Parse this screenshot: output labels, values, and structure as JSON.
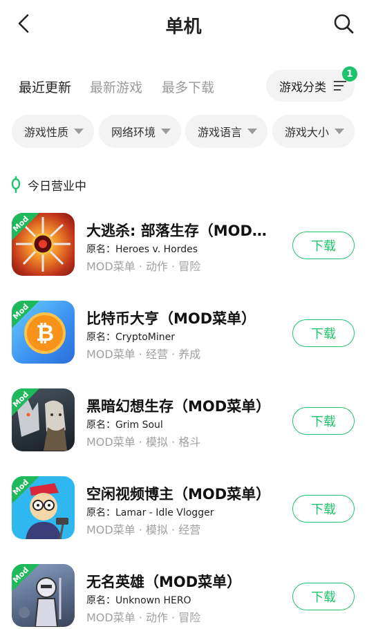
{
  "header": {
    "title": "单机",
    "back_icon": "chevron-left-icon",
    "search_icon": "search-icon"
  },
  "tabs": [
    {
      "label": "最近更新",
      "active": true
    },
    {
      "label": "最新游戏",
      "active": false
    },
    {
      "label": "最多下载",
      "active": false
    }
  ],
  "category_button": {
    "label": "游戏分类",
    "badge": "1",
    "icon": "filter-lines-icon"
  },
  "filters": [
    {
      "label": "游戏性质"
    },
    {
      "label": "网络环境"
    },
    {
      "label": "游戏语言"
    },
    {
      "label": "游戏大小"
    }
  ],
  "section": {
    "label": "今日营业中",
    "icon": "location-pin-icon",
    "accent": "#1ec46b"
  },
  "mod_tag": "Mod",
  "apps": [
    {
      "name": "大逃杀: 部落生存（MOD菜单）",
      "orig_prefix": "原名：",
      "orig": "Heroes v. Hordes",
      "tags": "MOD菜单 · 动作 · 冒险",
      "download": "下载"
    },
    {
      "name": "比特币大亨（MOD菜单）",
      "orig_prefix": "原名：",
      "orig": "CryptoMiner",
      "tags": "MOD菜单 · 经营 · 养成",
      "download": "下载"
    },
    {
      "name": "黑暗幻想生存（MOD菜单）",
      "orig_prefix": "原名：",
      "orig": "Grim Soul",
      "tags": "MOD菜单 · 模拟 · 格斗",
      "download": "下载"
    },
    {
      "name": "空闲视频博主（MOD菜单）",
      "orig_prefix": "原名：",
      "orig": "Lamar - Idle Vlogger",
      "tags": "MOD菜单 · 模拟 · 经营",
      "download": "下载"
    },
    {
      "name": "无名英雄（MOD菜单）",
      "orig_prefix": "原名：",
      "orig": "Unknown HERO",
      "tags": "MOD菜单 · 动作 · 冒险",
      "download": "下载"
    }
  ],
  "colors": {
    "accent_green": "#1ec46b",
    "chip_bg": "#f3f3f3",
    "muted_text": "#a0a0a0"
  }
}
